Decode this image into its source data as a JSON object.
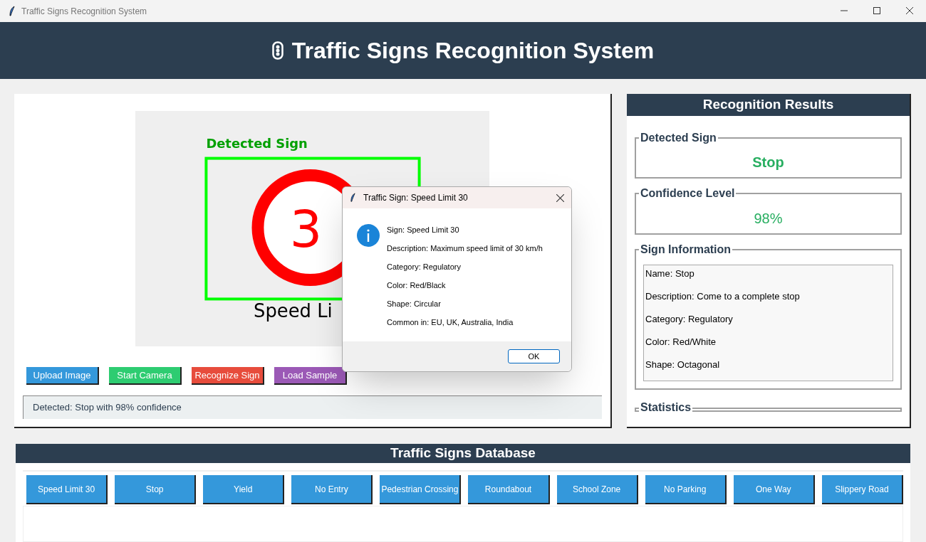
{
  "window": {
    "title": "Traffic Signs Recognition System"
  },
  "header": {
    "title": "Traffic Signs Recognition System"
  },
  "image_view": {
    "label": "Detected Sign",
    "sign_text": "3",
    "caption": "Speed Li"
  },
  "actions": [
    {
      "label": "Upload Image",
      "color": "#3498db"
    },
    {
      "label": "Start Camera",
      "color": "#2ecc71"
    },
    {
      "label": "Recognize Sign",
      "color": "#e74c3c"
    },
    {
      "label": "Load Sample",
      "color": "#9b59b6"
    }
  ],
  "status": "Detected: Stop with 98% confidence",
  "results": {
    "title": "Recognition Results",
    "detected_sign": {
      "label": "Detected Sign",
      "value": "Stop"
    },
    "confidence": {
      "label": "Confidence Level",
      "value": "98%"
    },
    "sign_info": {
      "label": "Sign Information",
      "lines": [
        "Name: Stop",
        "Description: Come to a complete stop",
        "Category: Regulatory",
        "Color: Red/White",
        "Shape: Octagonal"
      ]
    },
    "statistics": {
      "label": "Statistics"
    }
  },
  "database": {
    "title": "Traffic Signs Database",
    "signs": [
      "Speed Limit 30",
      "Stop",
      "Yield",
      "No Entry",
      "Pedestrian Crossing",
      "Roundabout",
      "School Zone",
      "No Parking",
      "One Way",
      "Slippery Road"
    ]
  },
  "dialog": {
    "title": "Traffic Sign: Speed Limit 30",
    "lines": [
      "Sign: Speed Limit 30",
      "Description: Maximum speed limit of 30 km/h",
      "Category: Regulatory",
      "Color: Red/Black",
      "Shape: Circular",
      "Common in: EU, UK, Australia, India"
    ],
    "button": "OK"
  }
}
